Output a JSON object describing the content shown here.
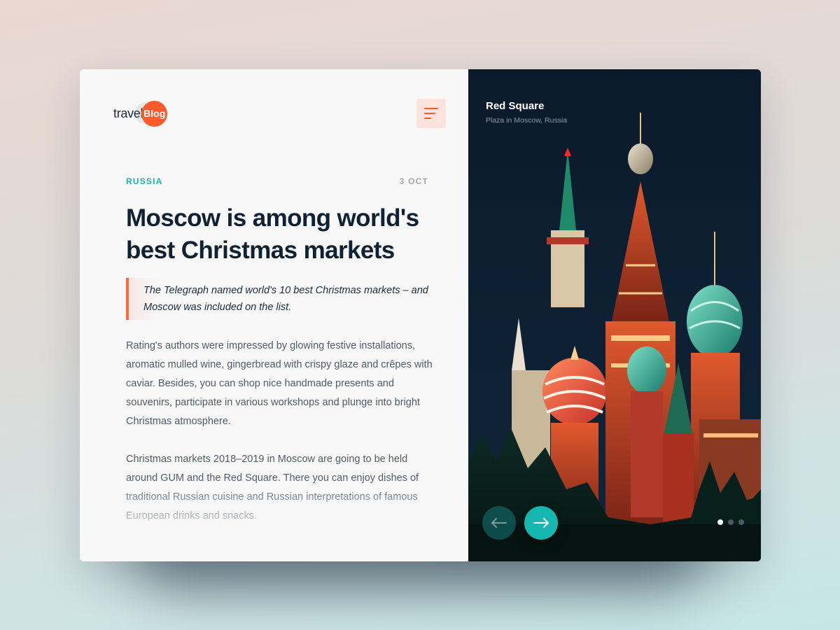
{
  "logo": {
    "word": "travel",
    "badge": "Blog"
  },
  "menu": {
    "icon": "hamburger-menu-icon"
  },
  "article": {
    "category": "RUSSIA",
    "date": "3 OCT",
    "title": "Moscow is among world's best Christmas markets",
    "quote": "The Telegraph named world's 10 best Christmas markets – and Moscow was included on the list.",
    "paragraphs": [
      "Rating's authors were impressed by glowing festive installations, aromatic mulled wine, gingerbread with crispy glaze and crêpes with caviar. Besides, you can shop nice handmade presents and souvenirs, participate in various workshops and plunge into bright Christmas atmosphere.",
      "Christmas markets 2018–2019 in Moscow are going to be held around GUM and the Red Square. There you can enjoy dishes of traditional Russian cuisine and Russian interpretations of famous European drinks and snacks."
    ]
  },
  "gallery": {
    "title": "Red Square",
    "subtitle": "Plaza in Moscow, Russia",
    "prev_icon": "arrow-left-icon",
    "next_icon": "arrow-right-icon",
    "slide_index": 1,
    "slide_count": 3
  },
  "colors": {
    "accent": "#ff5a2c",
    "teal": "#16b7b1",
    "heading": "#0f2233",
    "body_text": "#4f5c68",
    "image_bg": "#0c1b2c"
  }
}
